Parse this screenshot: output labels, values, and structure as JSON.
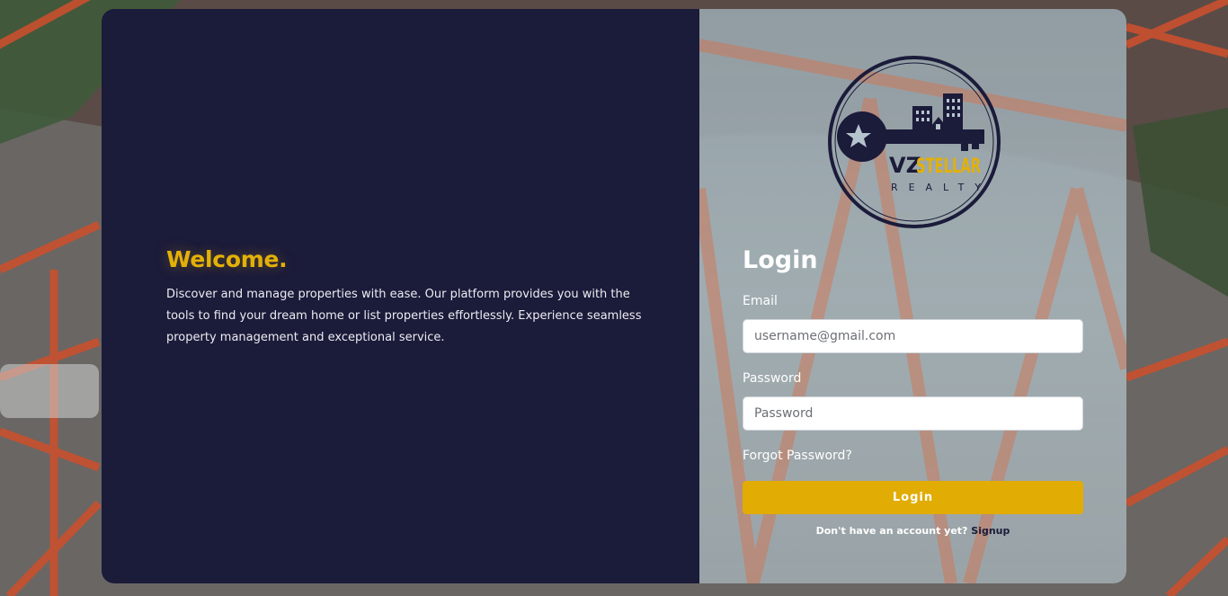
{
  "colors": {
    "left_panel": "#1b1b3a",
    "accent": "#e1ac04",
    "welcome": "#e3b008",
    "signup_link": "#1b1b3a"
  },
  "welcome": {
    "title": "Welcome.",
    "description": "Discover and manage properties with ease. Our platform provides you with the tools to find your dream home or list properties effortlessly. Experience seamless property management and exceptional service."
  },
  "logo": {
    "line1_a": "VZ",
    "line1_b": "STELLAR",
    "line2": "REALTY",
    "icon": "key-with-buildings-icon"
  },
  "login": {
    "title": "Login",
    "email_label": "Email",
    "email_placeholder": "username@gmail.com",
    "password_label": "Password",
    "password_placeholder": "Password",
    "forgot_label": "Forgot Password?",
    "button_label": "Login",
    "signup_prompt": "Don't have an account yet?",
    "signup_label": "Signup"
  }
}
